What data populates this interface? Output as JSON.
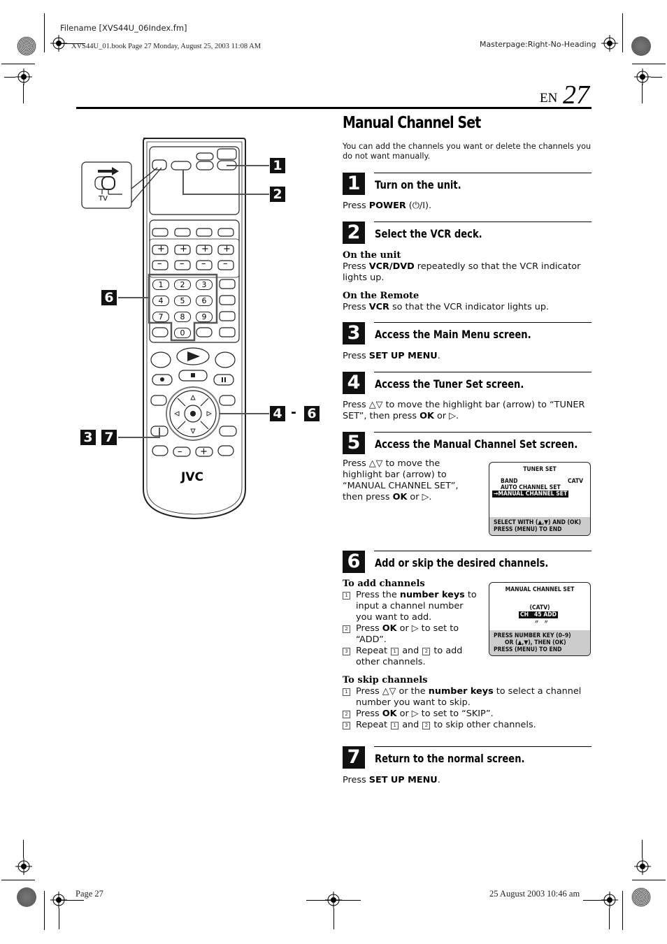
{
  "print_marks": {
    "filename": "Filename [XVS44U_06Index.fm]",
    "book_line": "XVS44U_01.book  Page 27  Monday, August 25, 2003  11:08 AM",
    "masterpage": "Masterpage:Right-No-Heading",
    "footer_page": "Page 27",
    "footer_date": "25 August 2003 10:46 am"
  },
  "page_number": {
    "lang": "EN",
    "number": "27"
  },
  "title": "Manual Channel Set",
  "intro": "You can add the channels you want or delete the channels you do not want manually.",
  "steps": [
    {
      "num": "1",
      "heading": "Turn on the unit.",
      "text_pre": "Press ",
      "text_bold": "POWER",
      "text_post": " (⏻/I)."
    },
    {
      "num": "2",
      "heading": "Select the VCR deck.",
      "unit_label": "On the unit",
      "unit_pre": "Press ",
      "unit_bold": "VCR/DVD",
      "unit_post": " repeatedly so that the VCR indicator lights up.",
      "remote_label": "On the Remote",
      "remote_pre": "Press ",
      "remote_bold": "VCR",
      "remote_post": " so that the VCR indicator lights up."
    },
    {
      "num": "3",
      "heading": "Access the Main Menu screen.",
      "text_pre": "Press ",
      "text_bold": "SET UP MENU",
      "text_post": "."
    },
    {
      "num": "4",
      "heading": "Access the Tuner Set screen.",
      "text_a": "Press △▽ to move the highlight bar (arrow) to “TUNER SET”, then press ",
      "text_bold": "OK",
      "text_b": " or ▷."
    },
    {
      "num": "5",
      "heading": "Access the Manual Channel Set screen.",
      "text_a": "Press △▽ to move the highlight bar (arrow) to “MANUAL CHANNEL SET”, then press ",
      "text_bold": "OK",
      "text_b": " or ▷."
    },
    {
      "num": "6",
      "heading": "Add or skip the desired channels.",
      "add_label": "To add channels",
      "add_items": [
        {
          "n": "1",
          "pre": "Press the ",
          "bold": "number keys",
          "post": " to input a channel number you want to add."
        },
        {
          "n": "2",
          "pre": "Press ",
          "bold": "OK",
          "post": " or ▷ to set to “ADD”."
        },
        {
          "n": "3",
          "pre": "Repeat ",
          "ref1": "1",
          "mid": " and ",
          "ref2": "2",
          "post": " to add other channels."
        }
      ],
      "skip_label": "To skip channels",
      "skip_items": [
        {
          "n": "1",
          "pre": "Press △▽ or the ",
          "bold": "number keys",
          "post": " to select a channel number you want to skip."
        },
        {
          "n": "2",
          "pre": "Press ",
          "bold": "OK",
          "post": " or ▷ to set to “SKIP”."
        },
        {
          "n": "3",
          "pre": "Repeat ",
          "ref1": "1",
          "mid": " and ",
          "ref2": "2",
          "post": " to skip other channels."
        }
      ]
    },
    {
      "num": "7",
      "heading": "Return to the normal screen.",
      "text_pre": "Press ",
      "text_bold": "SET UP MENU",
      "text_post": "."
    }
  ],
  "osd_tuner": {
    "title": "TUNER SET",
    "band_label": "BAND",
    "band_value": "CATV",
    "auto": "AUTO CHANNEL SET",
    "manual": "→MANUAL CHANNEL SET",
    "footer1": "SELECT WITH (▲,▼) AND (OK)",
    "footer2": "PRESS (MENU) TO END"
  },
  "osd_manual": {
    "title": "MANUAL CHANNEL SET",
    "band": "(CATV)",
    "ch_label": "CH",
    "ch_num": "45",
    "status": "ADD",
    "footer1": "PRESS NUMBER KEY (0–9)",
    "footer2": "OR (▲,▼), THEN (OK)",
    "footer3": "PRESS (MENU) TO END"
  },
  "remote": {
    "brand": "JVC",
    "switch_label": "TV",
    "callouts": {
      "c1": "1",
      "c2": "2",
      "c6": "6",
      "c4": "4",
      "dash": "-",
      "c6b": "6",
      "c3": "3",
      "c7": "7"
    },
    "keys": [
      "1",
      "2",
      "3",
      "4",
      "5",
      "6",
      "7",
      "8",
      "9",
      "0"
    ],
    "plus": "+",
    "minus": "–"
  }
}
